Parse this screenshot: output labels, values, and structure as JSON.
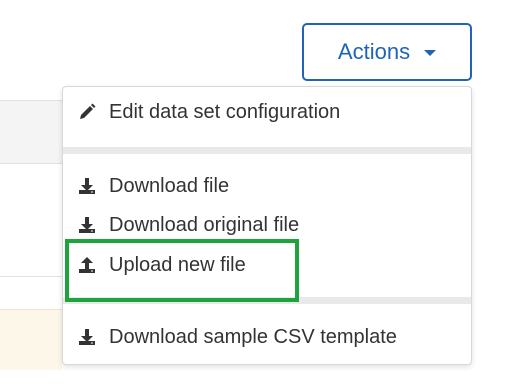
{
  "actions_button": {
    "label": "Actions"
  },
  "menu": {
    "items": [
      {
        "label": "Edit data set configuration",
        "icon": "pencil-icon"
      },
      {
        "label": "Download file",
        "icon": "download-icon"
      },
      {
        "label": "Download original file",
        "icon": "download-icon"
      },
      {
        "label": "Upload new file",
        "icon": "upload-icon"
      },
      {
        "label": "Download sample CSV template",
        "icon": "download-icon"
      }
    ]
  },
  "colors": {
    "accent": "#1f64b6",
    "highlight": "#1da43c",
    "divider": "#e9e9e9"
  }
}
